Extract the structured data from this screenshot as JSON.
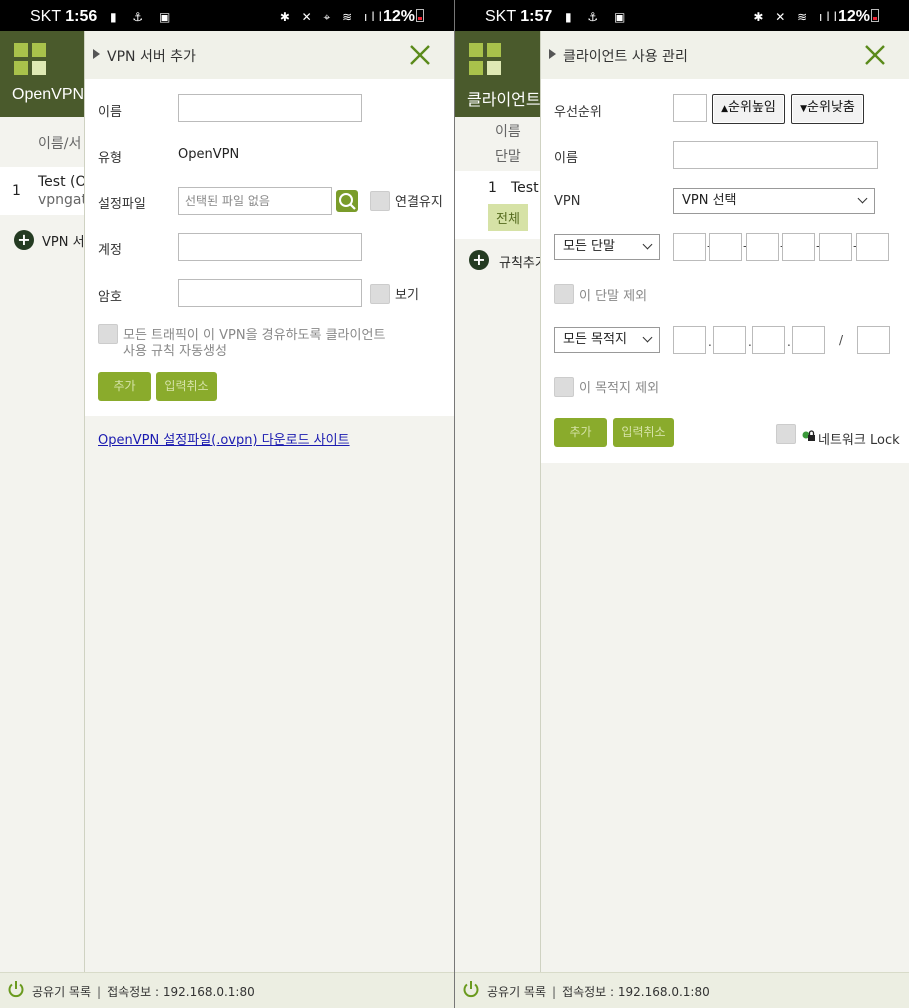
{
  "left": {
    "status": {
      "carrier": "SKT",
      "time": "1:56",
      "battery": "12%"
    },
    "app": {
      "title": "OpenVPN",
      "bg_column": "이름/서",
      "bg_row_index": "1",
      "bg_row_name": "Test (O",
      "bg_row_sub": "vpngat",
      "bg_add": "VPN 서"
    },
    "dialog": {
      "title": "VPN 서버 추가",
      "name_label": "이름",
      "name_value": "",
      "type_label": "유형",
      "type_value": "OpenVPN",
      "config_label": "설정파일",
      "config_placeholder": "선택된 파일 없음",
      "keep_alive_label": "연결유지",
      "account_label": "계정",
      "account_value": "",
      "password_label": "암호",
      "password_value": "",
      "show_label": "보기",
      "auto_rule_line1": "모든 트래픽이 이 VPN을 경유하도록 클라이언트",
      "auto_rule_line2": "사용 규칙 자동생성",
      "add_button": "추가",
      "cancel_button": "입력취소",
      "download_link": "OpenVPN 설정파일(.ovpn) 다운로드 사이트"
    },
    "bottom": {
      "router_list": "공유기 목록",
      "conn_info": "접속정보 : 192.168.0.1:80"
    }
  },
  "right": {
    "status": {
      "carrier": "SKT",
      "time": "1:57",
      "battery": "12%"
    },
    "app": {
      "title": "클라이언트",
      "bg_col1": "이름",
      "bg_col2": "단말",
      "bg_row_index": "1",
      "bg_row_name": "Test",
      "bg_chip": "전체",
      "bg_add": "규칙추가"
    },
    "dialog": {
      "title": "클라이언트 사용 관리",
      "priority_label": "우선순위",
      "priority_value": "",
      "priority_up": "순위높임",
      "priority_down": "순위낮춤",
      "name_label": "이름",
      "name_value": "",
      "vpn_label": "VPN",
      "vpn_select": "VPN 선택",
      "device_select": "모든 단말",
      "exclude_device": "이 단말 제외",
      "dest_select": "모든 목적지",
      "ip_slash": "/",
      "exclude_dest": "이 목적지 제외",
      "add_button": "추가",
      "cancel_button": "입력취소",
      "network_lock": "네트워크 Lock"
    },
    "bottom": {
      "router_list": "공유기 목록",
      "conn_info": "접속정보 : 192.168.0.1:80"
    }
  },
  "colors": {
    "accent": "#8aab2c",
    "header": "#4a5a2c",
    "close": "#5a8a1a"
  }
}
